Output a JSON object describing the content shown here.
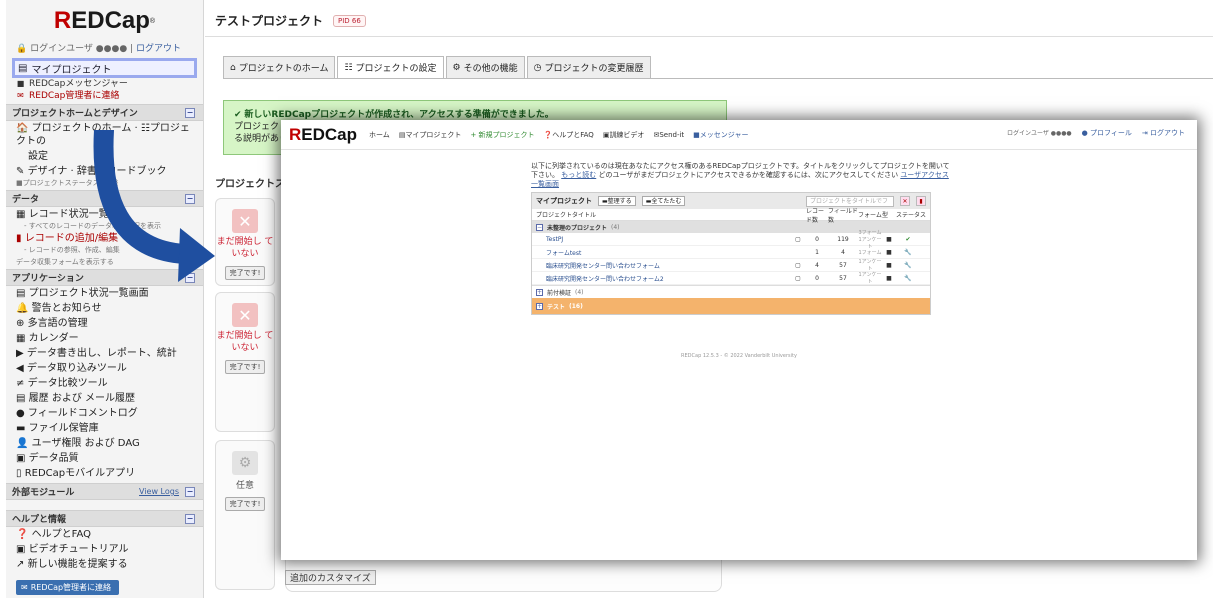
{
  "sidebar": {
    "logo_main": "REDCap",
    "logo_r": "R",
    "logo_rest": "EDCap",
    "user_prefix": "ログインユーザ ●●●●",
    "logout": "ログアウト",
    "my_projects": "マイプロジェクト",
    "redcap_messenger": "REDCapメッセンジャー",
    "contact_admin": "REDCap管理者に連絡",
    "sections": [
      {
        "title": "プロジェクトホームとデザイン"
      },
      {
        "title": "データ"
      },
      {
        "title": "アプリケーション"
      },
      {
        "title": "外部モジュール",
        "extra": "View Logs"
      },
      {
        "title": "ヘルプと情報"
      }
    ],
    "home_design": [
      "プロジェクトのホーム · ☷プロジェクトの",
      "設定",
      "デザイナ · 辞書 · コードブック",
      "プロジェクトステータス: 開発"
    ],
    "data": {
      "record_status": "レコード状況一覧",
      "record_status_sub": "- すべてのレコードのデータ収集状況を表示",
      "add_edit": "レコードの追加/編集",
      "add_edit_sub": "- レコードの参照、作成、編集",
      "forms_note": "データ収集フォームを表示する"
    },
    "apps": [
      "プロジェクト状況一覧画面",
      "警告とお知らせ",
      "多言語の管理",
      "カレンダー",
      "データ書き出し、レポート、統計",
      "データ取り込みツール",
      "データ比較ツール",
      "履歴 および メール履歴",
      "フィールドコメントログ",
      "ファイル保管庫",
      "ユーザ権限 および DAG",
      "データ品質",
      "REDCapモバイルアプリ"
    ],
    "help": [
      "ヘルプとFAQ",
      "ビデオチュートリアル",
      "新しい機能を提案する"
    ],
    "contact_button": "REDCap管理者に連絡"
  },
  "main": {
    "title": "テストプロジェクト",
    "pid": "PID 66",
    "tabs": [
      "プロジェクトのホーム",
      "プロジェクトの設定",
      "その他の機能",
      "プロジェクトの変更履歴"
    ],
    "success_title": "新しいREDCapプロジェクトが作成され、アクセスする準備ができました。",
    "success_body_1": "プロジェクト",
    "success_body_2": "る説明があり",
    "status_heading": "プロジェクトステ",
    "card_not_started": "まだ開始し ていない",
    "card_done": "完了です!",
    "card_optional": "任意",
    "customize": "追加のカスタマイズ"
  },
  "overlay": {
    "logo_r": "R",
    "logo_rest": "EDCap",
    "nav": [
      "ホーム",
      "マイプロジェクト",
      "+ 新規プロジェクト",
      "ヘルプとFAQ",
      "訓練ビデオ",
      "Send-it",
      "メッセンジャー"
    ],
    "login_user": "ログインユーザ ●●●●",
    "profile": "プロフィール",
    "logout": "ログアウト",
    "intro_1": "以下に列挙されているのは現在あなたにアクセス権のあるREDCapプロジェクトです。タイトルをクリックしてプロジェクトを開いて下さい。",
    "intro_link1": "もっと読む",
    "intro_2": "どのユーザがまだプロジェクトにアクセスできるかを確認するには、次にアクセスしてください",
    "intro_link2": "ユーザアクセス一覧画面",
    "table": {
      "header": "マイプロジェクト",
      "btn_organize": "整理する",
      "btn_collapse": "全てたたむ",
      "search_placeholder": "プロジェクトをタイトルでフ",
      "col_title": "プロジェクトタイトル",
      "col_records": "レコード数",
      "col_fields": "フィールド数",
      "col_forms": "フォーム",
      "col_type": "型",
      "col_status": "ステータス",
      "folder_unorganized": "未整理のプロジェクト",
      "folder_unorganized_count": "(4)",
      "rows": [
        {
          "title": "TestPJ",
          "records": "0",
          "fields": "119",
          "forms": "3フォーム 1アンケート",
          "status": "✔"
        },
        {
          "title": "フォームtest",
          "records": "1",
          "fields": "4",
          "forms": "1フォーム",
          "status": "🔧"
        },
        {
          "title": "臨床研究開発センター問い合わせフォーム",
          "records": "4",
          "fields": "57",
          "forms": "1アンケート",
          "status": "🔧"
        },
        {
          "title": "臨床研究開発センター問い合わせフォーム2",
          "records": "0",
          "fields": "57",
          "forms": "1アンケート",
          "status": "🔧"
        }
      ],
      "folder_2": "前付検証",
      "folder_2_count": "(4)",
      "folder_3": "テスト",
      "folder_3_count": "(16)"
    },
    "footer": "REDCap 12.5.3 - © 2022 Vanderbilt University"
  },
  "colors": {
    "accent": "#3a6fb0",
    "success_bg": "#d6f5c6",
    "orange": "#f4b36c",
    "arrow": "#1f4fa0"
  }
}
